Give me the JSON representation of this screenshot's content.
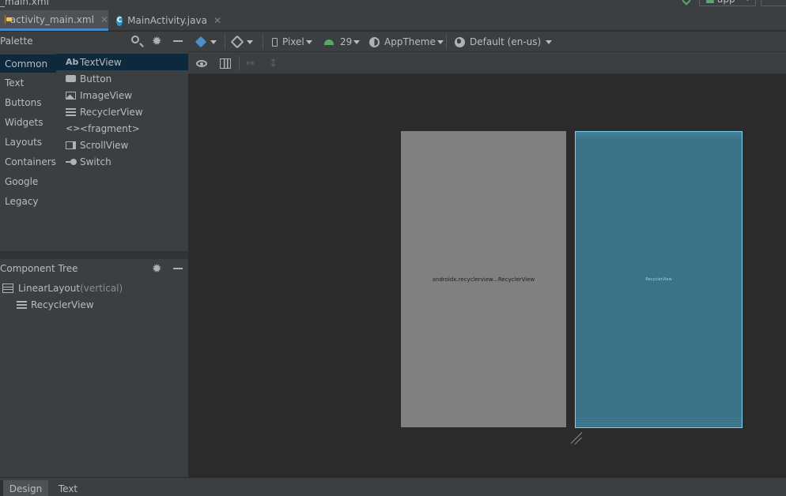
{
  "colors": {
    "background": "#2b2b2b",
    "panel": "#3c3f41",
    "selection": "#0d293e",
    "active_tab_underline": "#4a88c7",
    "design_surface": "#808080",
    "blueprint_surface": "#3b7287",
    "blueprint_border": "#7ed1ef",
    "android_green": "#59a869"
  },
  "window": {
    "crumb": "_main.xml",
    "run_config_label": "app"
  },
  "editor_tabs": [
    {
      "label": "activity_main.xml",
      "icon": "xml-file-icon",
      "active": true
    },
    {
      "label": "MainActivity.java",
      "icon": "java-class-icon",
      "active": false
    }
  ],
  "palette": {
    "title": "Palette",
    "categories": [
      "Common",
      "Text",
      "Buttons",
      "Widgets",
      "Layouts",
      "Containers",
      "Google",
      "Legacy"
    ],
    "selected_category": "Common",
    "widgets": [
      {
        "label": "TextView",
        "icon": "text-view-icon",
        "glyph": "Ab"
      },
      {
        "label": "Button",
        "icon": "button-icon"
      },
      {
        "label": "ImageView",
        "icon": "image-view-icon"
      },
      {
        "label": "RecyclerView",
        "icon": "recycler-view-icon"
      },
      {
        "label": "<fragment>",
        "icon": "fragment-icon",
        "glyph": "<>"
      },
      {
        "label": "ScrollView",
        "icon": "scroll-view-icon"
      },
      {
        "label": "Switch",
        "icon": "switch-icon"
      }
    ]
  },
  "component_tree": {
    "title": "Component Tree",
    "root": {
      "label": "LinearLayout",
      "qualifier": "(vertical)"
    },
    "child": {
      "label": "RecyclerView"
    }
  },
  "toolbar": {
    "device": "Pixel",
    "api_level": "29",
    "theme": "AppTheme",
    "locale": "Default (en-us)"
  },
  "canvas": {
    "design_label": "androidx.recyclerview...RecyclerView",
    "blueprint_label": "RecyclerView"
  },
  "bottom_tabs": [
    {
      "label": "Design",
      "active": true
    },
    {
      "label": "Text",
      "active": false
    }
  ]
}
